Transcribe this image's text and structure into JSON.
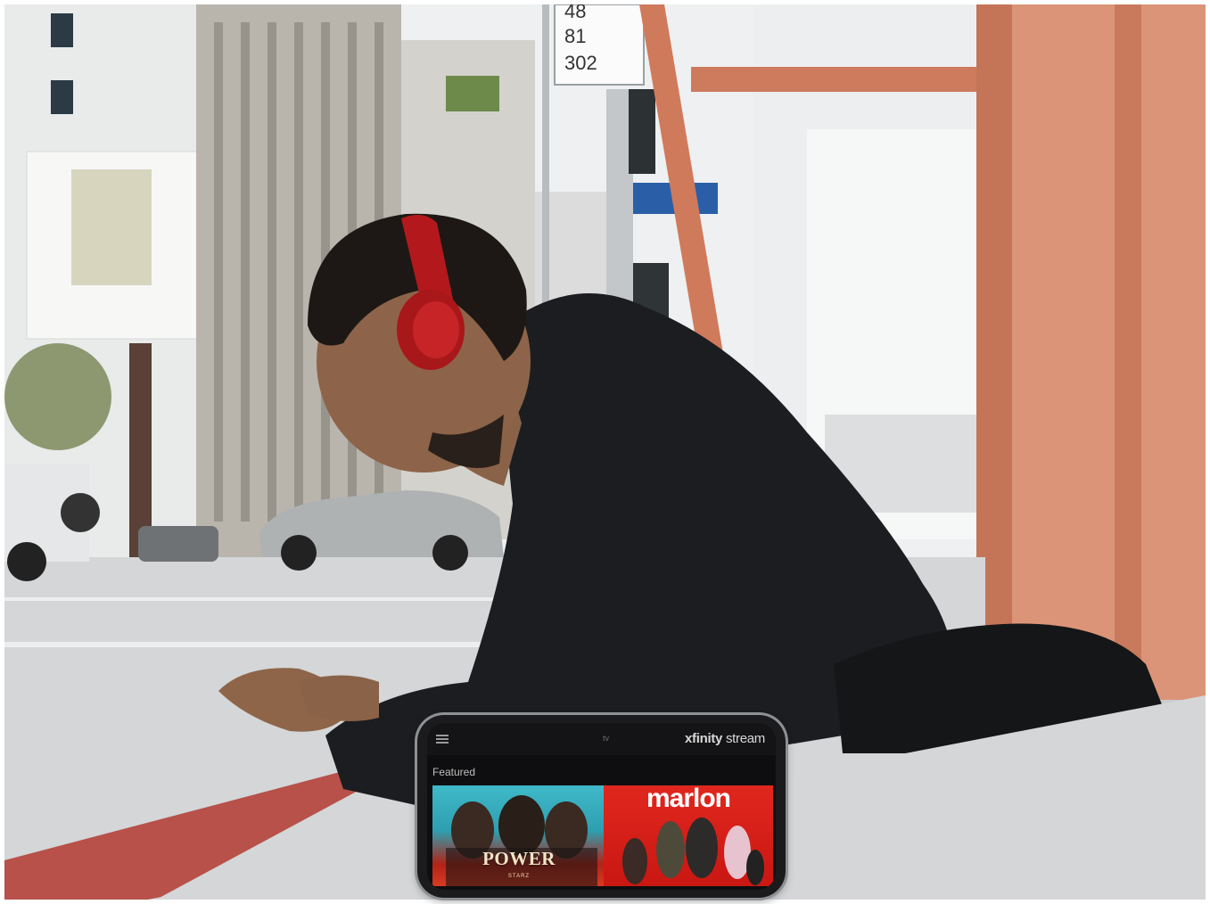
{
  "scene": {
    "colors": {
      "sky": "#eef0f1",
      "street": "#d4d6d8",
      "jacket": "#1c1d20",
      "headphones": "#b3191c",
      "shelter": "#d5876b",
      "footer_band": "#d5d6d8"
    },
    "bus_sign_numbers": [
      "48",
      "81",
      "302"
    ]
  },
  "phone": {
    "menu_icon": "hamburger-menu-icon",
    "tv_label": "tv",
    "brand_light": "xfinity",
    "brand_bold": "stream",
    "section_title": "Featured",
    "tiles": [
      {
        "title": "POWER",
        "subtitle": "STARZ",
        "accent": "#3fb9c8"
      },
      {
        "title": "marlon",
        "accent": "#e0271e"
      }
    ]
  }
}
